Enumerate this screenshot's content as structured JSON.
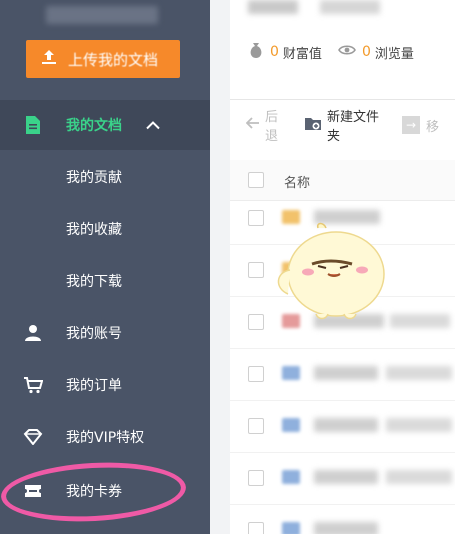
{
  "sidebar": {
    "upload_label": "上传我的文档",
    "my_docs_label": "我的文档",
    "items": [
      {
        "label": "我的贡献"
      },
      {
        "label": "我的收藏"
      },
      {
        "label": "我的下载"
      },
      {
        "label": "我的账号"
      },
      {
        "label": "我的订单"
      },
      {
        "label": "我的VIP特权"
      },
      {
        "label": "我的卡券"
      }
    ]
  },
  "header": {
    "stats": [
      {
        "value": "0",
        "label": "财富值"
      },
      {
        "value": "0",
        "label": "浏览量"
      }
    ]
  },
  "toolbar": {
    "back_label": "后退",
    "new_folder_label": "新建文件夹",
    "more_label": "移"
  },
  "table": {
    "name_header": "名称"
  },
  "colors": {
    "sidebar_bg": "#4a5467",
    "accent_green": "#3ad28a",
    "upload_orange": "#f6892a",
    "highlight_pink": "#ef5aa6",
    "stat_orange": "#f39a2a"
  },
  "icons": {
    "upload": "upload-icon",
    "document": "document-icon",
    "chevron_up": "chevron-up-icon",
    "user": "user-icon",
    "cart": "cart-icon",
    "diamond": "diamond-icon",
    "ticket": "ticket-icon",
    "moneybag": "money-bag-icon",
    "eye": "eye-icon",
    "back": "back-arrow-icon",
    "new_folder": "new-folder-icon"
  }
}
